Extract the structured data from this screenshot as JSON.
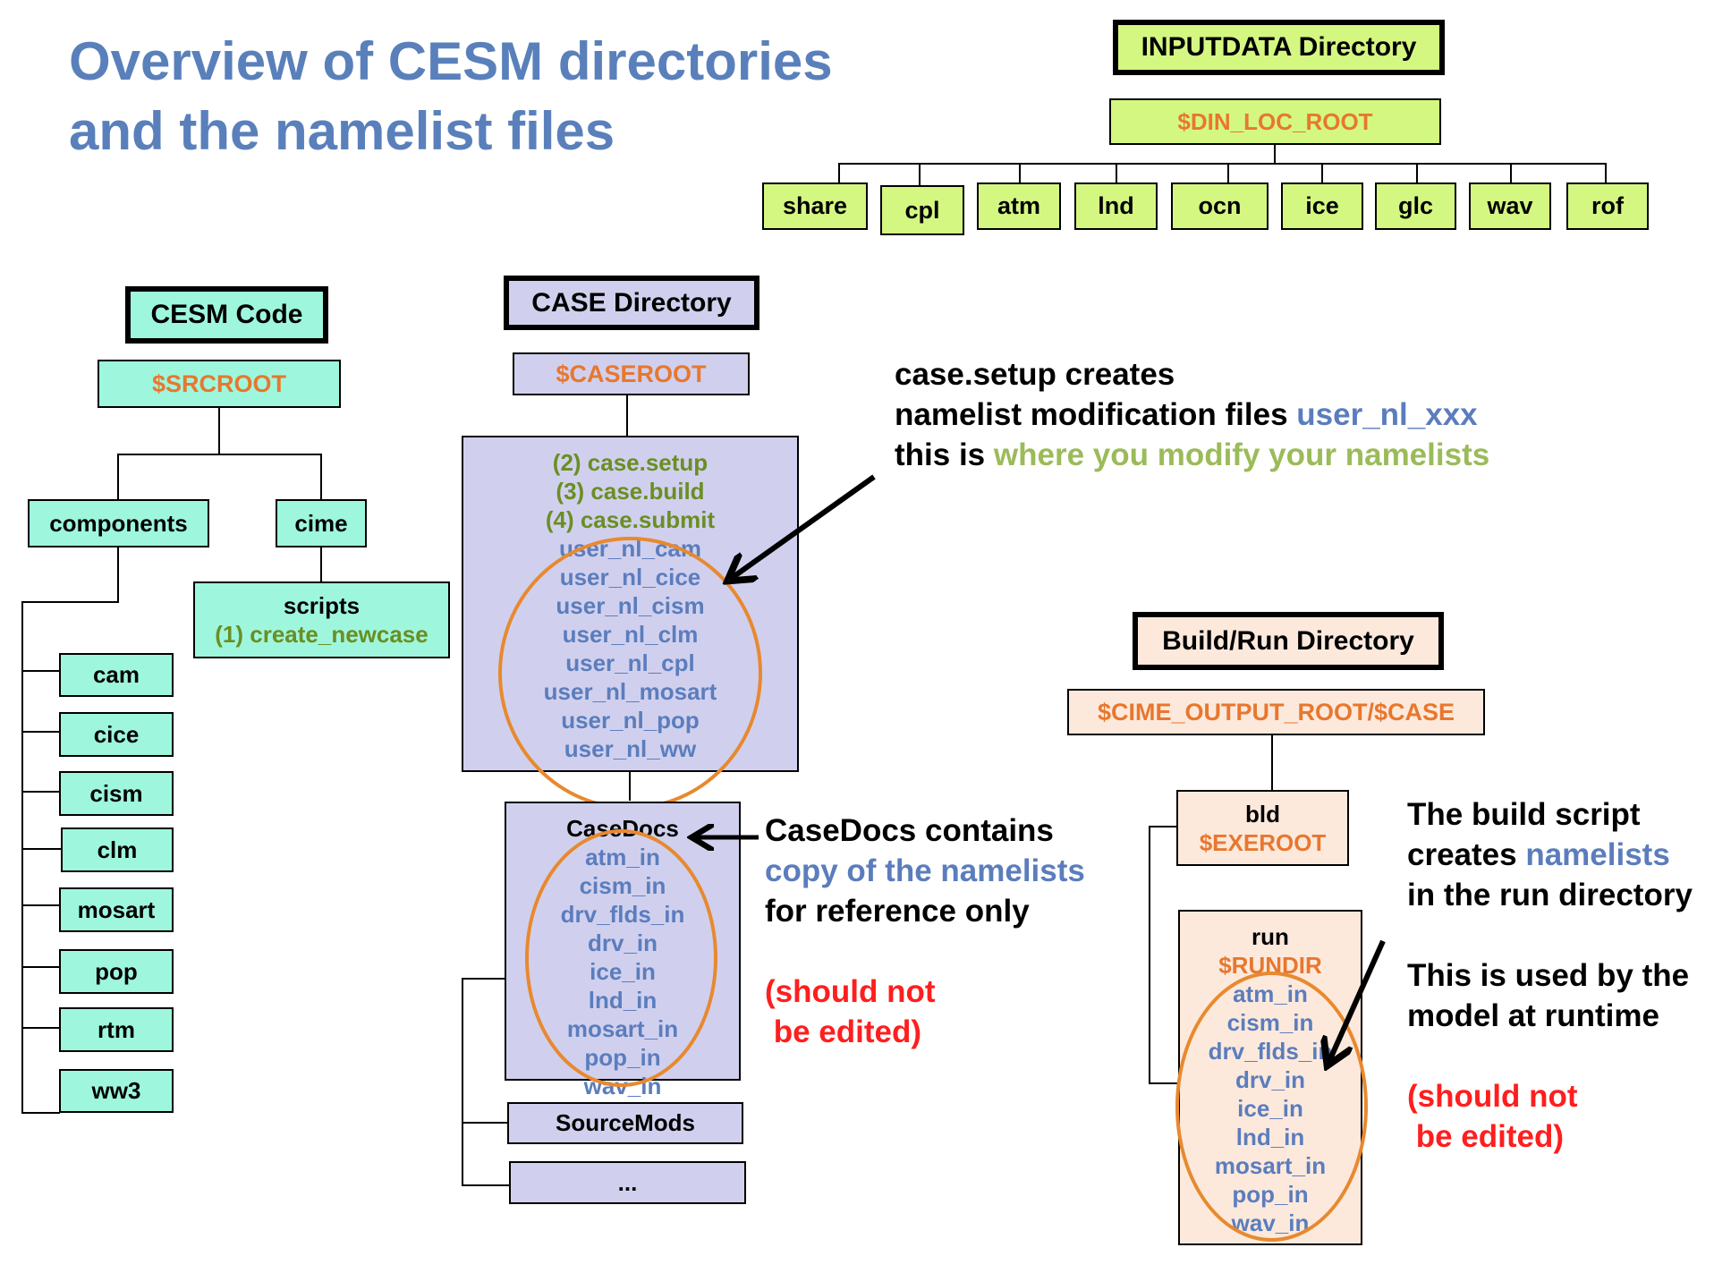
{
  "title": {
    "line1": "Overview of CESM directories",
    "line2": "and the namelist files"
  },
  "colors": {
    "title": "#5a80bb",
    "inputdata_fill": "#d4f782",
    "cesm_code_fill": "#9ef7dd",
    "case_fill": "#d0d0ee",
    "buildrun_fill": "#fce9dc",
    "variable_text": "#e8772e",
    "namelist_text": "#5b7dbd",
    "step_text": "#6b8e23",
    "highlight_green": "#9bbb59",
    "warning_red": "#ff1e1e",
    "ellipse": "#e8892f"
  },
  "inputdata": {
    "header": "INPUTDATA Directory",
    "root": "$DIN_LOC_ROOT",
    "children": [
      "share",
      "cpl",
      "atm",
      "lnd",
      "ocn",
      "ice",
      "glc",
      "wav",
      "rof"
    ]
  },
  "cesm_code": {
    "header": "CESM Code",
    "root": "$SRCROOT",
    "components_label": "components",
    "cime_label": "cime",
    "scripts_label": "scripts",
    "scripts_step": "(1) create_newcase",
    "components": [
      "cam",
      "cice",
      "cism",
      "clm",
      "mosart",
      "pop",
      "rtm",
      "ww3"
    ]
  },
  "case_dir": {
    "header": "CASE Directory",
    "root": "$CASEROOT",
    "steps": [
      "(2) case.setup",
      "(3) case.build",
      "(4) case.submit"
    ],
    "user_nl_files": [
      "user_nl_cam",
      "user_nl_cice",
      "user_nl_cism",
      "user_nl_clm",
      "user_nl_cpl",
      "user_nl_mosart",
      "user_nl_pop",
      "user_nl_ww"
    ],
    "casedocs_label": "CaseDocs",
    "casedocs_files": [
      "atm_in",
      "cism_in",
      "drv_flds_in",
      "drv_in",
      "ice_in",
      "lnd_in",
      "mosart_in",
      "pop_in",
      "wav_in"
    ],
    "sourcemods_label": "SourceMods",
    "more_label": "..."
  },
  "buildrun": {
    "header": "Build/Run Directory",
    "root": "$CIME_OUTPUT_ROOT/$CASE",
    "bld_label": "bld",
    "bld_var": "$EXEROOT",
    "run_label": "run",
    "run_var": "$RUNDIR",
    "run_files": [
      "atm_in",
      "cism_in",
      "drv_flds_in",
      "drv_in",
      "ice_in",
      "lnd_in",
      "mosart_in",
      "pop_in",
      "wav_in"
    ]
  },
  "notes": {
    "case_setup": {
      "line1": "case.setup creates",
      "line2_prefix": "namelist modification files ",
      "line2_highlight": "user_nl_xxx",
      "line3_prefix": "this is ",
      "line3_highlight": "where you modify your namelists"
    },
    "casedocs": {
      "line1": "CaseDocs contains",
      "line2": "copy of the namelists",
      "line3": "for reference only",
      "warn1": "(should not",
      "warn2": " be edited)"
    },
    "build": {
      "line1": "The build script",
      "line2_prefix": "creates ",
      "line2_highlight": "namelists",
      "line3": "in the run directory",
      "line4": "This is used by the",
      "line5": "model at runtime",
      "warn1": "(should not",
      "warn2": " be edited)"
    }
  }
}
